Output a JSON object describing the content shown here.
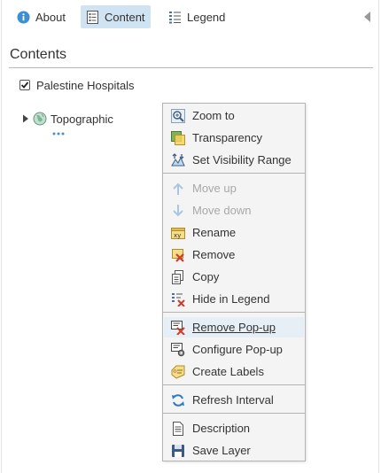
{
  "tabs": {
    "about": "About",
    "content": "Content",
    "legend": "Legend"
  },
  "contents": {
    "title": "Contents",
    "layers": [
      {
        "name": "Palestine Hospitals",
        "checked": true
      },
      {
        "name": "Topographic"
      }
    ]
  },
  "menu": {
    "zoom_to": "Zoom to",
    "transparency": "Transparency",
    "visibility_range": "Set Visibility Range",
    "move_up": "Move up",
    "move_down": "Move down",
    "rename": "Rename",
    "remove": "Remove",
    "copy": "Copy",
    "hide_in_legend": "Hide in Legend",
    "remove_popup": "Remove Pop-up",
    "configure_popup": "Configure Pop-up",
    "create_labels": "Create Labels",
    "refresh_interval": "Refresh Interval",
    "description": "Description",
    "save_layer": "Save Layer"
  },
  "colors": {
    "selected_tab": "#cfe3f2",
    "menu_bg": "#f4f4f4",
    "accent_blue": "#2b7bc2",
    "disabled_text": "#a8a8a8"
  }
}
